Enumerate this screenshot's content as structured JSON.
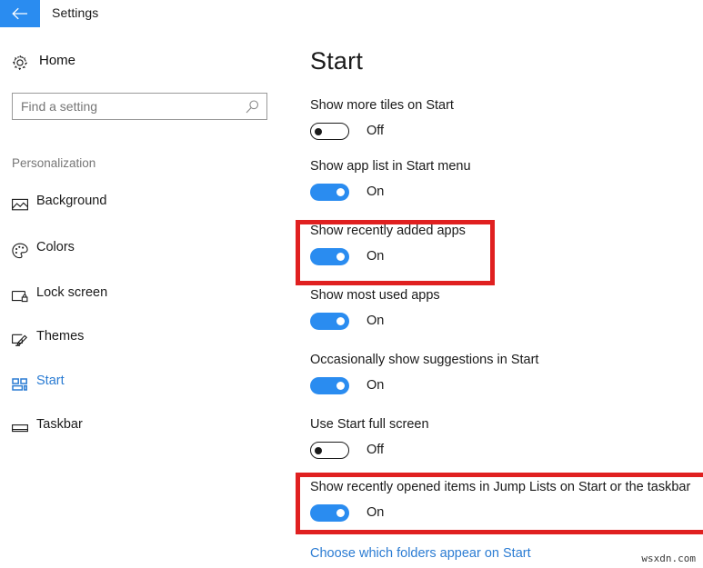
{
  "window": {
    "title": "Settings",
    "back_icon": "back-arrow-icon"
  },
  "sidebar": {
    "home": {
      "label": "Home",
      "icon": "gear-icon"
    },
    "search": {
      "value": "",
      "placeholder": "Find a setting",
      "icon": "search-icon"
    },
    "section_label": "Personalization",
    "items": [
      {
        "label": "Background",
        "icon": "picture-icon",
        "selected": false
      },
      {
        "label": "Colors",
        "icon": "palette-icon",
        "selected": false
      },
      {
        "label": "Lock screen",
        "icon": "lock-screen-icon",
        "selected": false
      },
      {
        "label": "Themes",
        "icon": "theme-brush-icon",
        "selected": false
      },
      {
        "label": "Start",
        "icon": "start-tiles-icon",
        "selected": true
      },
      {
        "label": "Taskbar",
        "icon": "taskbar-icon",
        "selected": false
      }
    ]
  },
  "main": {
    "title": "Start",
    "settings": [
      {
        "label": "Show more tiles on Start",
        "state": "Off",
        "on": false
      },
      {
        "label": "Show app list in Start menu",
        "state": "On",
        "on": true
      },
      {
        "label": "Show recently added apps",
        "state": "On",
        "on": true
      },
      {
        "label": "Show most used apps",
        "state": "On",
        "on": true
      },
      {
        "label": "Occasionally show suggestions in Start",
        "state": "On",
        "on": true
      },
      {
        "label": "Use Start full screen",
        "state": "Off",
        "on": false
      },
      {
        "label": "Show recently opened items in Jump Lists on Start or the taskbar",
        "state": "On",
        "on": true
      }
    ],
    "folders_link": "Choose which folders appear on Start"
  },
  "annotations": {
    "highlight_color": "#e02020",
    "accent_color": "#2a8cf0",
    "link_color": "#2b7cd3"
  },
  "watermark": "wsxdn.com"
}
